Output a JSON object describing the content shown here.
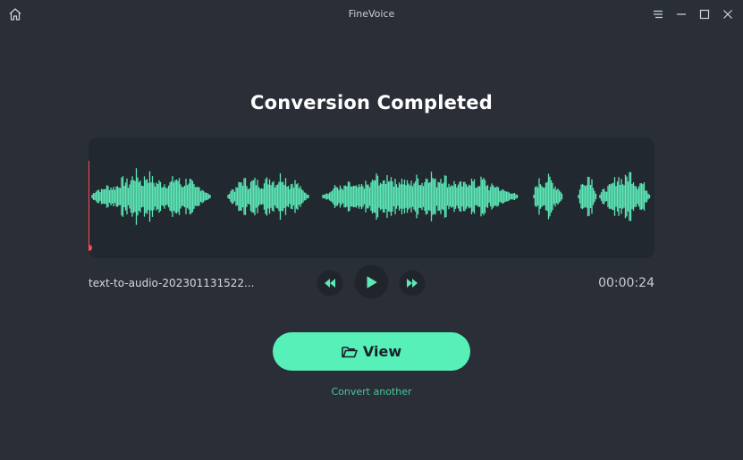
{
  "titlebar": {
    "app_title": "FineVoice",
    "icons": {
      "home": "home-icon",
      "menu": "menu-icon",
      "minimize": "minimize-icon",
      "maximize": "maximize-icon",
      "close": "close-icon"
    }
  },
  "main": {
    "heading": "Conversion Completed",
    "filename": "text-to-audio-202301131522...",
    "duration": "00:00:24",
    "playback_position": 0,
    "view_button_label": "View",
    "convert_another_label": "Convert another"
  },
  "transport": {
    "icons": {
      "rewind": "rewind-icon",
      "play": "play-icon",
      "forward": "fast-forward-icon"
    }
  },
  "colors": {
    "background": "#2a2f37",
    "panel": "#222830",
    "accent": "#58f0b9",
    "waveform": "#5de8b7",
    "playhead": "#ff4a4a",
    "link": "#46c89b"
  }
}
